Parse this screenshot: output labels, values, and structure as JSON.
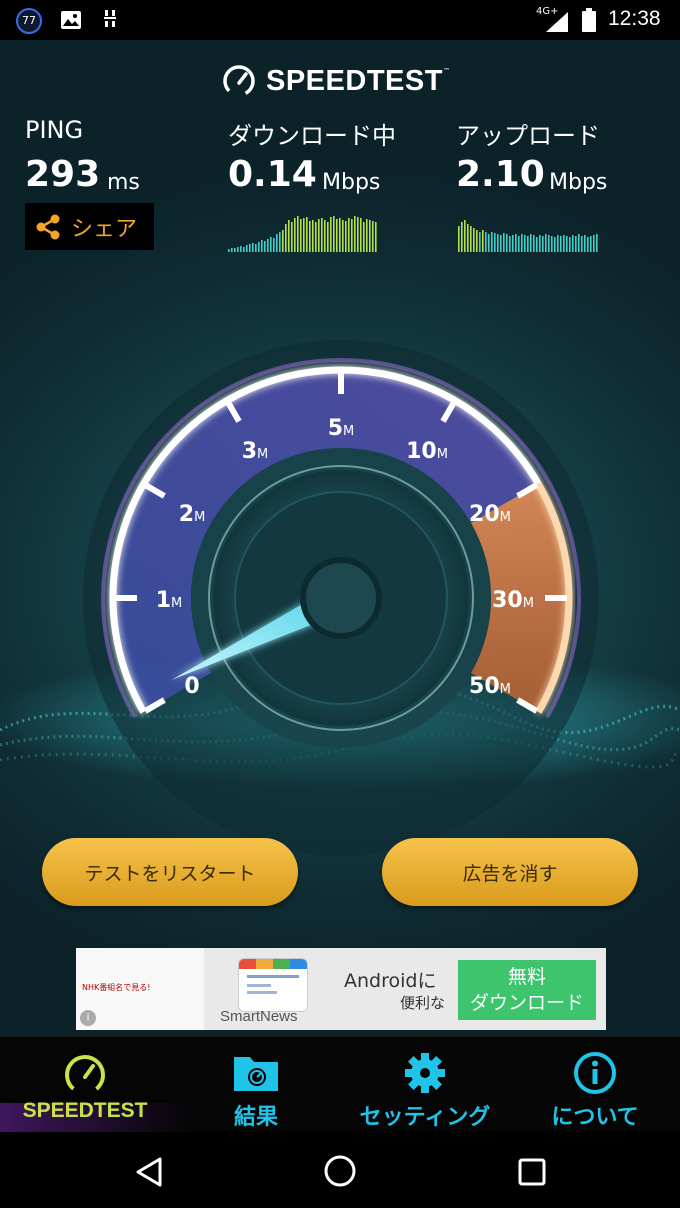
{
  "status_bar": {
    "notification_count": "77",
    "network_type": "4G+",
    "time": "12:38"
  },
  "app": {
    "logo_text": "SPEEDTEST",
    "trademark": "™"
  },
  "metrics": {
    "ping": {
      "label": "PING",
      "value": "293",
      "unit": "ms"
    },
    "download": {
      "label": "ダウンロード中",
      "value": "0.14",
      "unit": "Mbps"
    },
    "upload": {
      "label": "アップロード",
      "value": "2.10",
      "unit": "Mbps"
    }
  },
  "share_button": {
    "label": "シェア"
  },
  "gauge": {
    "ticks": [
      {
        "num": "0",
        "unit": ""
      },
      {
        "num": "1",
        "unit": "M"
      },
      {
        "num": "2",
        "unit": "M"
      },
      {
        "num": "3",
        "unit": "M"
      },
      {
        "num": "5",
        "unit": "M"
      },
      {
        "num": "10",
        "unit": "M"
      },
      {
        "num": "20",
        "unit": "M"
      },
      {
        "num": "30",
        "unit": "M"
      },
      {
        "num": "50",
        "unit": "M"
      }
    ],
    "current_mbps": 0.14
  },
  "buttons": {
    "restart": "テストをリスタート",
    "remove_ads": "広告を消す"
  },
  "ad": {
    "brand": "SmartNews",
    "headline": "Androidに",
    "subline": "便利な",
    "cta_line1": "無料",
    "cta_line2": "ダウンロード",
    "info": "i",
    "side_text": "NHK番組名で見る!"
  },
  "bottom_nav": [
    {
      "label": "SPEEDTEST",
      "icon": "speedometer-icon",
      "active": true
    },
    {
      "label": "結果",
      "icon": "results-folder-icon",
      "active": false
    },
    {
      "label": "セッティング",
      "icon": "gear-icon",
      "active": false
    },
    {
      "label": "について",
      "icon": "info-icon",
      "active": false
    }
  ],
  "colors": {
    "accent_gold": "#f5a623",
    "active_nav": "#c8e24a",
    "nav_blue": "#1fc4e8",
    "button_gold": "#e9ae2c"
  }
}
